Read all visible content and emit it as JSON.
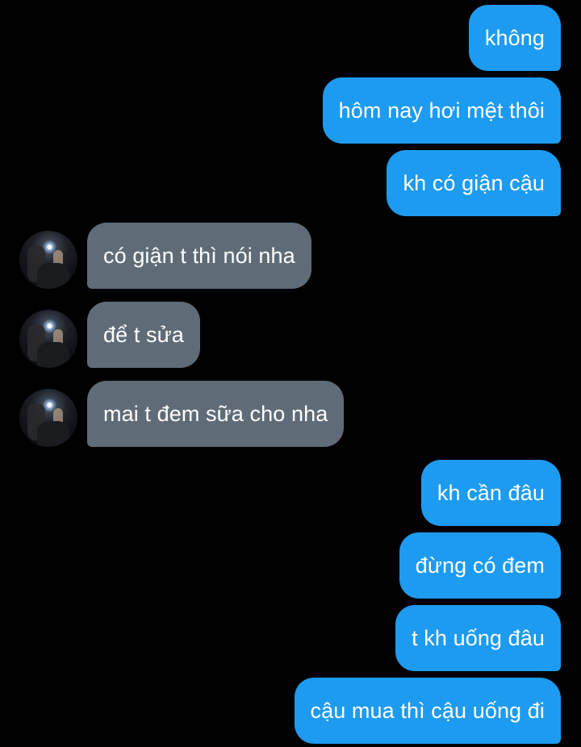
{
  "conversation": {
    "messages": [
      {
        "direction": "outgoing",
        "text": "không"
      },
      {
        "direction": "outgoing",
        "text": "hôm nay hơi mệt thôi"
      },
      {
        "direction": "outgoing",
        "text": "kh có giận cậu"
      },
      {
        "direction": "incoming",
        "text": "có giận t thì nói nha"
      },
      {
        "direction": "incoming",
        "text": "để t sửa"
      },
      {
        "direction": "incoming",
        "text": "mai t đem sữa cho nha"
      },
      {
        "direction": "outgoing",
        "text": "kh cần đâu"
      },
      {
        "direction": "outgoing",
        "text": "đừng có đem"
      },
      {
        "direction": "outgoing",
        "text": "t kh uống đâu"
      },
      {
        "direction": "outgoing",
        "text": "cậu mua thì cậu uống đi"
      }
    ]
  },
  "colors": {
    "background": "#000000",
    "outgoing_bubble": "#1d9bf0",
    "incoming_bubble": "#5f6c78",
    "text": "#ffffff"
  },
  "icons": {
    "avatar": "profile-photo"
  }
}
